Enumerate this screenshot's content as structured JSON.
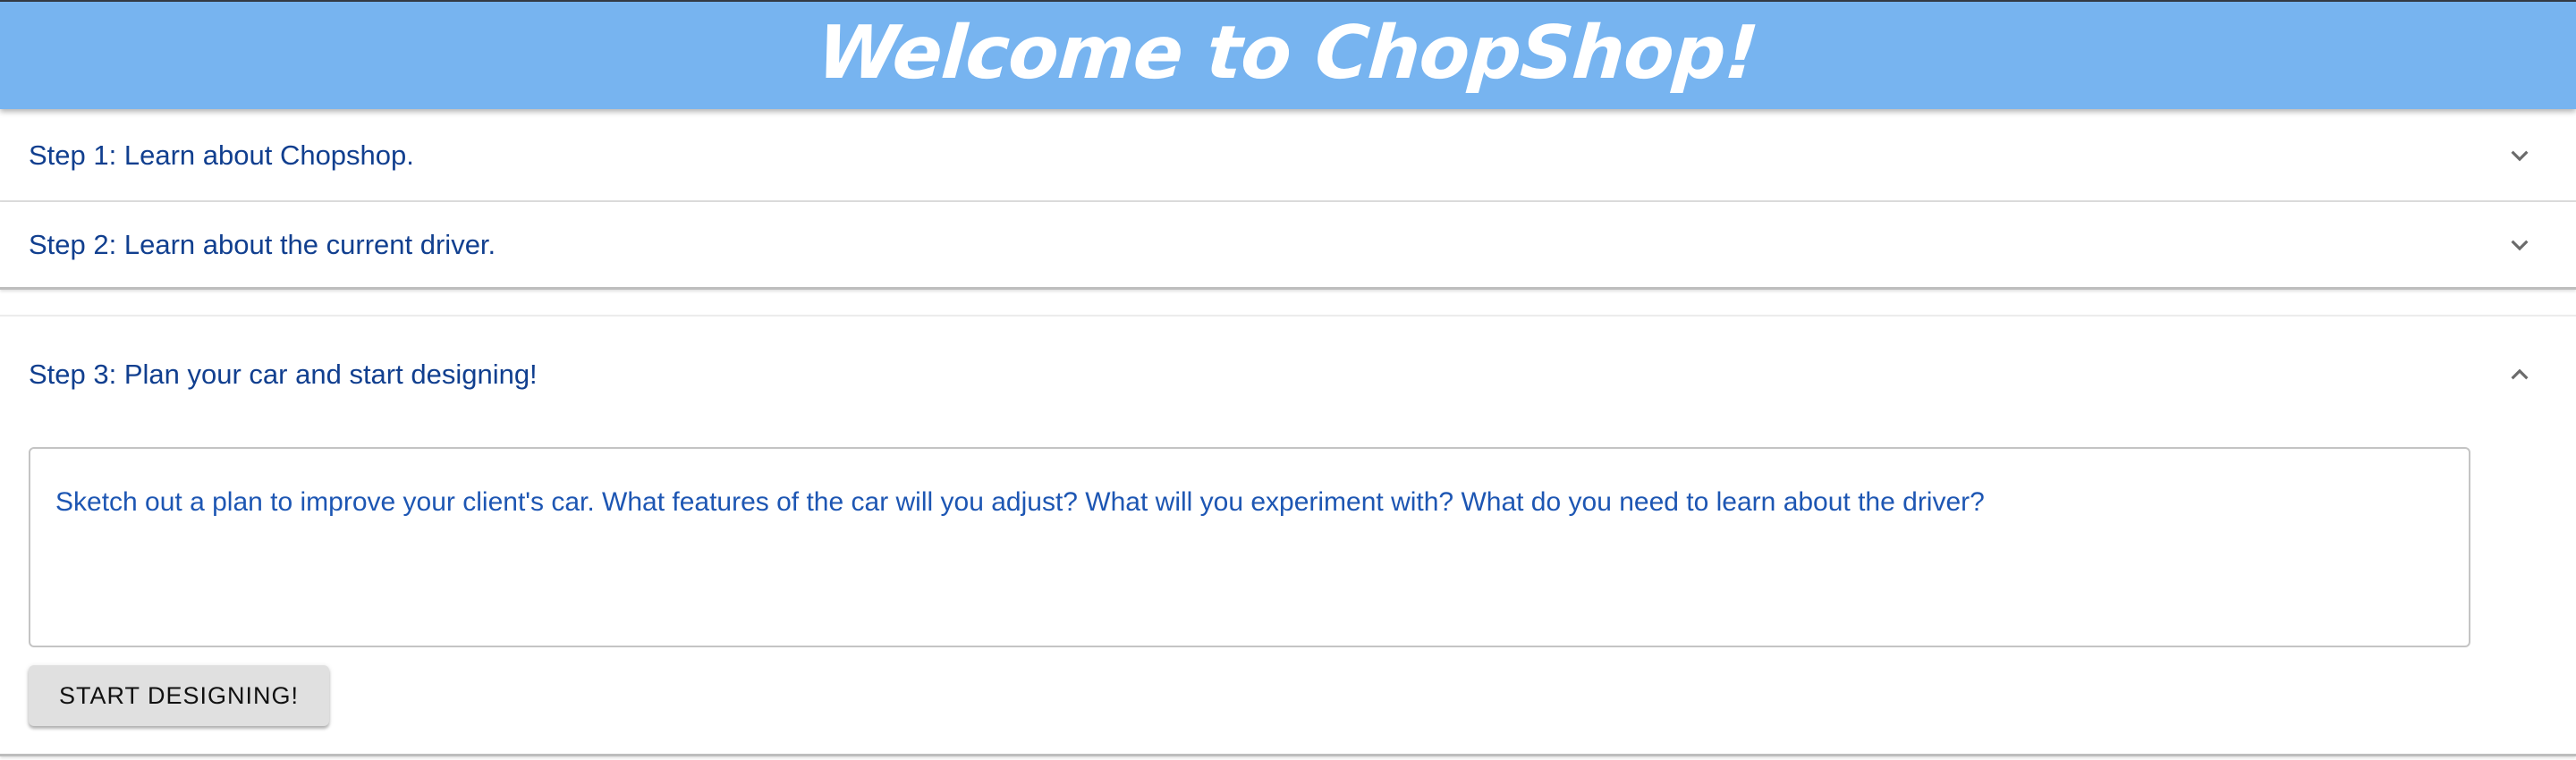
{
  "header": {
    "title": "Welcome to ChopShop!"
  },
  "steps": [
    {
      "label": "Step 1: Learn about Chopshop.",
      "expanded": false,
      "icon": "chevron-down-icon"
    },
    {
      "label": "Step 2: Learn about the current driver.",
      "expanded": false,
      "icon": "chevron-down-icon"
    },
    {
      "label": "Step 3: Plan your car and start designing!",
      "expanded": true,
      "icon": "chevron-up-icon"
    }
  ],
  "plan": {
    "placeholder": "Sketch out a plan to improve your client's car. What features of the car will you adjust? What will you experiment with? What do you need to learn about the driver?",
    "value": ""
  },
  "start_button": {
    "label": "START DESIGNING!"
  },
  "colors": {
    "header_bg": "#77b4f0",
    "step_text": "#113f8f",
    "plan_text": "#1d56b3",
    "button_bg": "#e0e0e0"
  }
}
